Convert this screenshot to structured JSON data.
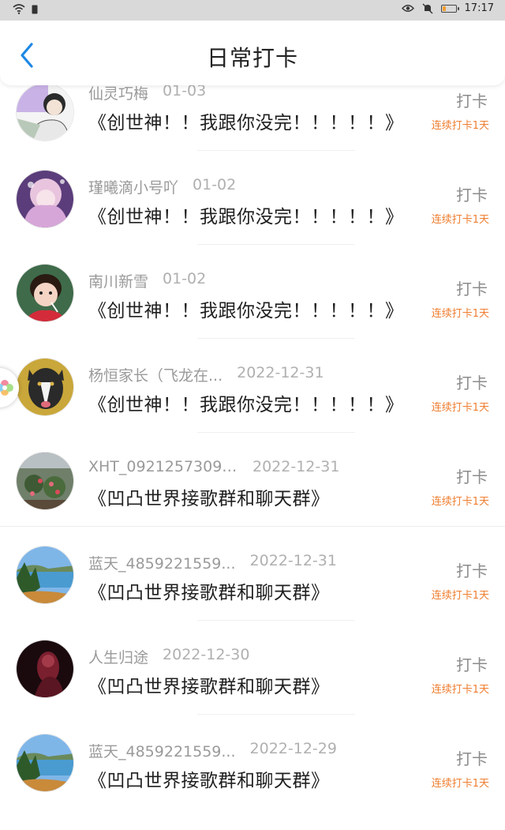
{
  "status_bar": {
    "time": "17:17",
    "battery_level": 0.25,
    "icons": [
      "wifi-icon",
      "sim-icon",
      "eye-icon",
      "mute-icon",
      "battery-icon"
    ]
  },
  "header": {
    "title": "日常打卡",
    "back_icon": "chevron-left-icon",
    "accent": "#1e88e5"
  },
  "list": [
    {
      "name": "仙灵巧梅",
      "date": "01-03",
      "content": "《创世神！！我跟你没完！！！！！》",
      "action": "打卡",
      "streak": "连续打卡1天"
    },
    {
      "name": "瑾曦滴小号吖",
      "date": "01-02",
      "content": "《创世神！！我跟你没完！！！！！》",
      "action": "打卡",
      "streak": "连续打卡1天"
    },
    {
      "name": "南川新雪",
      "date": "01-02",
      "content": "《创世神！！我跟你没完！！！！！》",
      "action": "打卡",
      "streak": "连续打卡1天"
    },
    {
      "name": "杨恒家长（飞龙在...",
      "date": "2022-12-31",
      "content": "《创世神！！我跟你没完！！！！！》",
      "action": "打卡",
      "streak": "连续打卡1天"
    },
    {
      "name": "XHT_09212573094..",
      "date": "2022-12-31",
      "content": "《凹凸世界接歌群和聊天群》",
      "action": "打卡",
      "streak": "连续打卡1天"
    },
    {
      "name": "蓝天_4859221559...",
      "date": "2022-12-31",
      "content": "《凹凸世界接歌群和聊天群》",
      "action": "打卡",
      "streak": "连续打卡1天"
    },
    {
      "name": "人生归途",
      "date": "2022-12-30",
      "content": "《凹凸世界接歌群和聊天群》",
      "action": "打卡",
      "streak": "连续打卡1天"
    },
    {
      "name": "蓝天_4859221559...",
      "date": "2022-12-29",
      "content": "《凹凸世界接歌群和聊天群》",
      "action": "打卡",
      "streak": "连续打卡1天"
    }
  ],
  "colors": {
    "streak": "#ef7d2f",
    "meta": "#9a9a9a"
  }
}
